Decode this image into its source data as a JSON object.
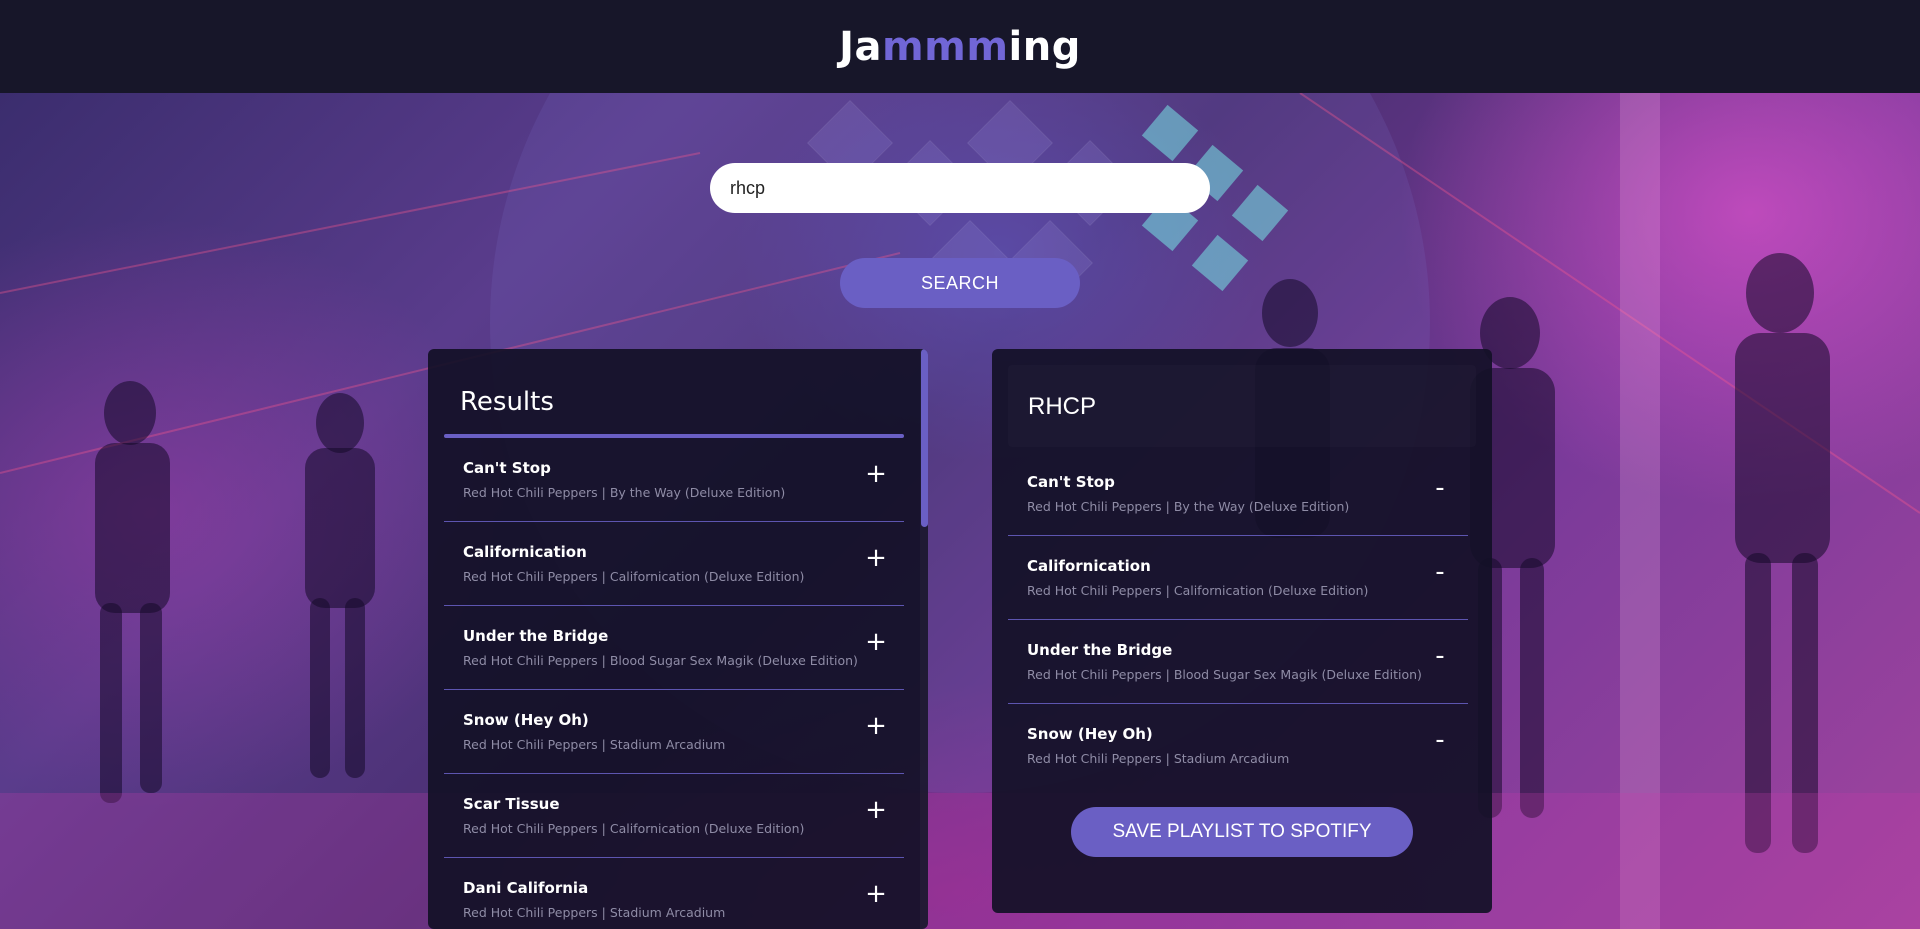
{
  "app": {
    "logo_part1": "Ja",
    "logo_part2": "mmm",
    "logo_part3": "ing"
  },
  "search": {
    "value": "rhcp",
    "button_label": "SEARCH"
  },
  "results": {
    "title": "Results",
    "add_symbol": "+",
    "tracks": [
      {
        "name": "Can't Stop",
        "meta": "Red Hot Chili Peppers | By the Way (Deluxe Edition)"
      },
      {
        "name": "Californication",
        "meta": "Red Hot Chili Peppers | Californication (Deluxe Edition)"
      },
      {
        "name": "Under the Bridge",
        "meta": "Red Hot Chili Peppers | Blood Sugar Sex Magik (Deluxe Edition)"
      },
      {
        "name": "Snow (Hey Oh)",
        "meta": "Red Hot Chili Peppers | Stadium Arcadium"
      },
      {
        "name": "Scar Tissue",
        "meta": "Red Hot Chili Peppers | Californication (Deluxe Edition)"
      },
      {
        "name": "Dani California",
        "meta": "Red Hot Chili Peppers | Stadium Arcadium"
      }
    ]
  },
  "playlist": {
    "name": "RHCP",
    "remove_symbol": "-",
    "tracks": [
      {
        "name": "Can't Stop",
        "meta": "Red Hot Chili Peppers | By the Way (Deluxe Edition)"
      },
      {
        "name": "Californication",
        "meta": "Red Hot Chili Peppers | Californication (Deluxe Edition)"
      },
      {
        "name": "Under the Bridge",
        "meta": "Red Hot Chili Peppers | Blood Sugar Sex Magik (Deluxe Edition)"
      },
      {
        "name": "Snow (Hey Oh)",
        "meta": "Red Hot Chili Peppers | Stadium Arcadium"
      }
    ],
    "save_label": "SAVE PLAYLIST TO SPOTIFY"
  },
  "colors": {
    "accent": "#6a5fc4",
    "header_bg": "#171629",
    "panel_bg": "#121026"
  }
}
